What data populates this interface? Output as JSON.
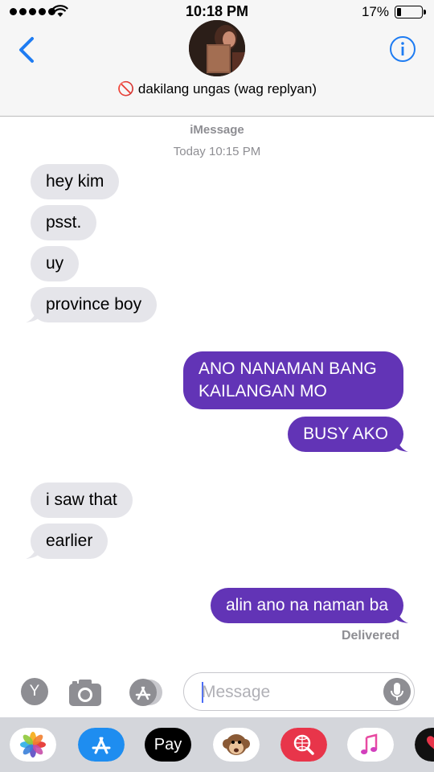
{
  "status_bar": {
    "time": "10:18 PM",
    "battery_percent_text": "17%",
    "battery_level": 0.17,
    "signal_bars": 5
  },
  "header": {
    "contact_emoji": "🚫",
    "contact_name": "dakilang ungas (wag replyan)",
    "back_icon": "chevron-left-icon",
    "info_icon": "info-icon"
  },
  "thread": {
    "service": "iMessage",
    "timestamp_day": "Today",
    "timestamp_time": "10:15 PM",
    "messages": [
      {
        "from": "them",
        "text": "hey kim"
      },
      {
        "from": "them",
        "text": "psst."
      },
      {
        "from": "them",
        "text": "uy"
      },
      {
        "from": "them",
        "text": "province boy"
      },
      {
        "from": "me",
        "text": "ANO NANAMAN BANG KAILANGAN MO"
      },
      {
        "from": "me",
        "text": "BUSY AKO"
      },
      {
        "from": "them",
        "text": "i saw that"
      },
      {
        "from": "them",
        "text": "earlier"
      },
      {
        "from": "me",
        "text": "alin ano na naman ba"
      }
    ],
    "delivery_status": "Delivered"
  },
  "compose": {
    "placeholder": "Message",
    "button_y_label": "Y",
    "camera_icon": "camera-icon",
    "appstore_icon": "app-store-icon",
    "mic_icon": "microphone-icon"
  },
  "app_drawer": {
    "apps": [
      {
        "name": "photos-icon"
      },
      {
        "name": "app-store-icon"
      },
      {
        "name": "apple-pay-icon",
        "label": "Pay"
      },
      {
        "name": "animoji-monkey-icon"
      },
      {
        "name": "web-search-icon"
      },
      {
        "name": "music-icon"
      },
      {
        "name": "digital-touch-icon"
      }
    ]
  },
  "colors": {
    "outgoing_bubble": "#6234b6",
    "incoming_bubble": "#e5e5ea",
    "ios_blue": "#1e7cf2",
    "secondary_text": "#8e8e93"
  }
}
